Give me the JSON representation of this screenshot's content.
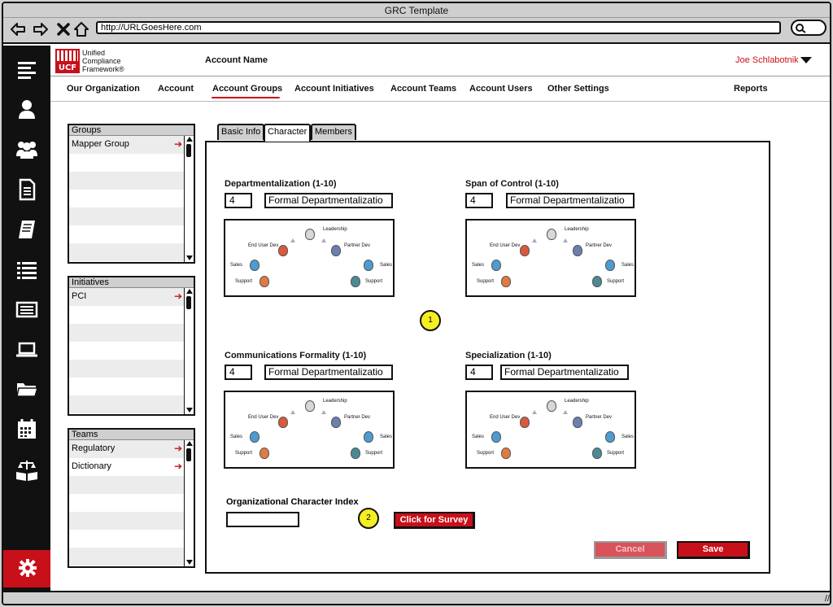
{
  "window": {
    "title": "GRC Template"
  },
  "browser": {
    "url": "http://URLGoesHere.com"
  },
  "header": {
    "logo_lines": [
      "Unified",
      "Compliance",
      "Framework®"
    ],
    "logo_mark": "UCF",
    "account_name": "Account Name",
    "user_name": "Joe Schlabotnik"
  },
  "menu": {
    "items": [
      "Our Organization",
      "Account",
      "Account Groups",
      "Account Initiatives",
      "Account Teams",
      "Account Users",
      "Other Settings",
      "Reports"
    ],
    "active": "Account Groups"
  },
  "groups": {
    "title": "Groups",
    "items": [
      "Mapper Group"
    ]
  },
  "initiatives": {
    "title": "Initiatives",
    "items": [
      "PCI"
    ]
  },
  "teams": {
    "title": "Teams",
    "items": [
      "Regulatory",
      "Dictionary"
    ]
  },
  "tabs": [
    "Basic Info",
    "Character",
    "Members"
  ],
  "active_tab": "Character",
  "metrics": [
    {
      "label": "Departmentalization (1-10)",
      "value": "4",
      "select": "Formal Departmentalizatio"
    },
    {
      "label": "Span of Control (1-10)",
      "value": "4",
      "select": "Formal Departmentalizatio"
    },
    {
      "label": "Communications Formality (1-10)",
      "value": "4",
      "select": "Formal Departmentalizatio"
    },
    {
      "label": "Specialization (1-10)",
      "value": "4",
      "select": "Formal Departmentalizatio"
    }
  ],
  "diagram_labels": {
    "leadership": "Leadership",
    "end_user_dev": "End User Dev",
    "partner_dev": "Partner Dev",
    "sales": "Sales",
    "support": "Support"
  },
  "badges": [
    "1",
    "2"
  ],
  "oci": {
    "label": "Organizational Character Index",
    "value": ""
  },
  "buttons": {
    "survey": "Click for Survey",
    "cancel": "Cancel",
    "save": "Save"
  },
  "colors": {
    "brand_red": "#c8101a",
    "highlight": "#f5ee21",
    "sidebar": "#111111"
  },
  "icons": [
    "back-arrow-icon",
    "forward-arrow-icon",
    "close-icon",
    "home-icon",
    "search-icon",
    "menu-icon",
    "user-icon",
    "users-icon",
    "document-icon",
    "book-icon",
    "list-icon",
    "card-icon",
    "laptop-icon",
    "folder-icon",
    "calendar-icon",
    "scales-book-icon",
    "gear-icon"
  ]
}
